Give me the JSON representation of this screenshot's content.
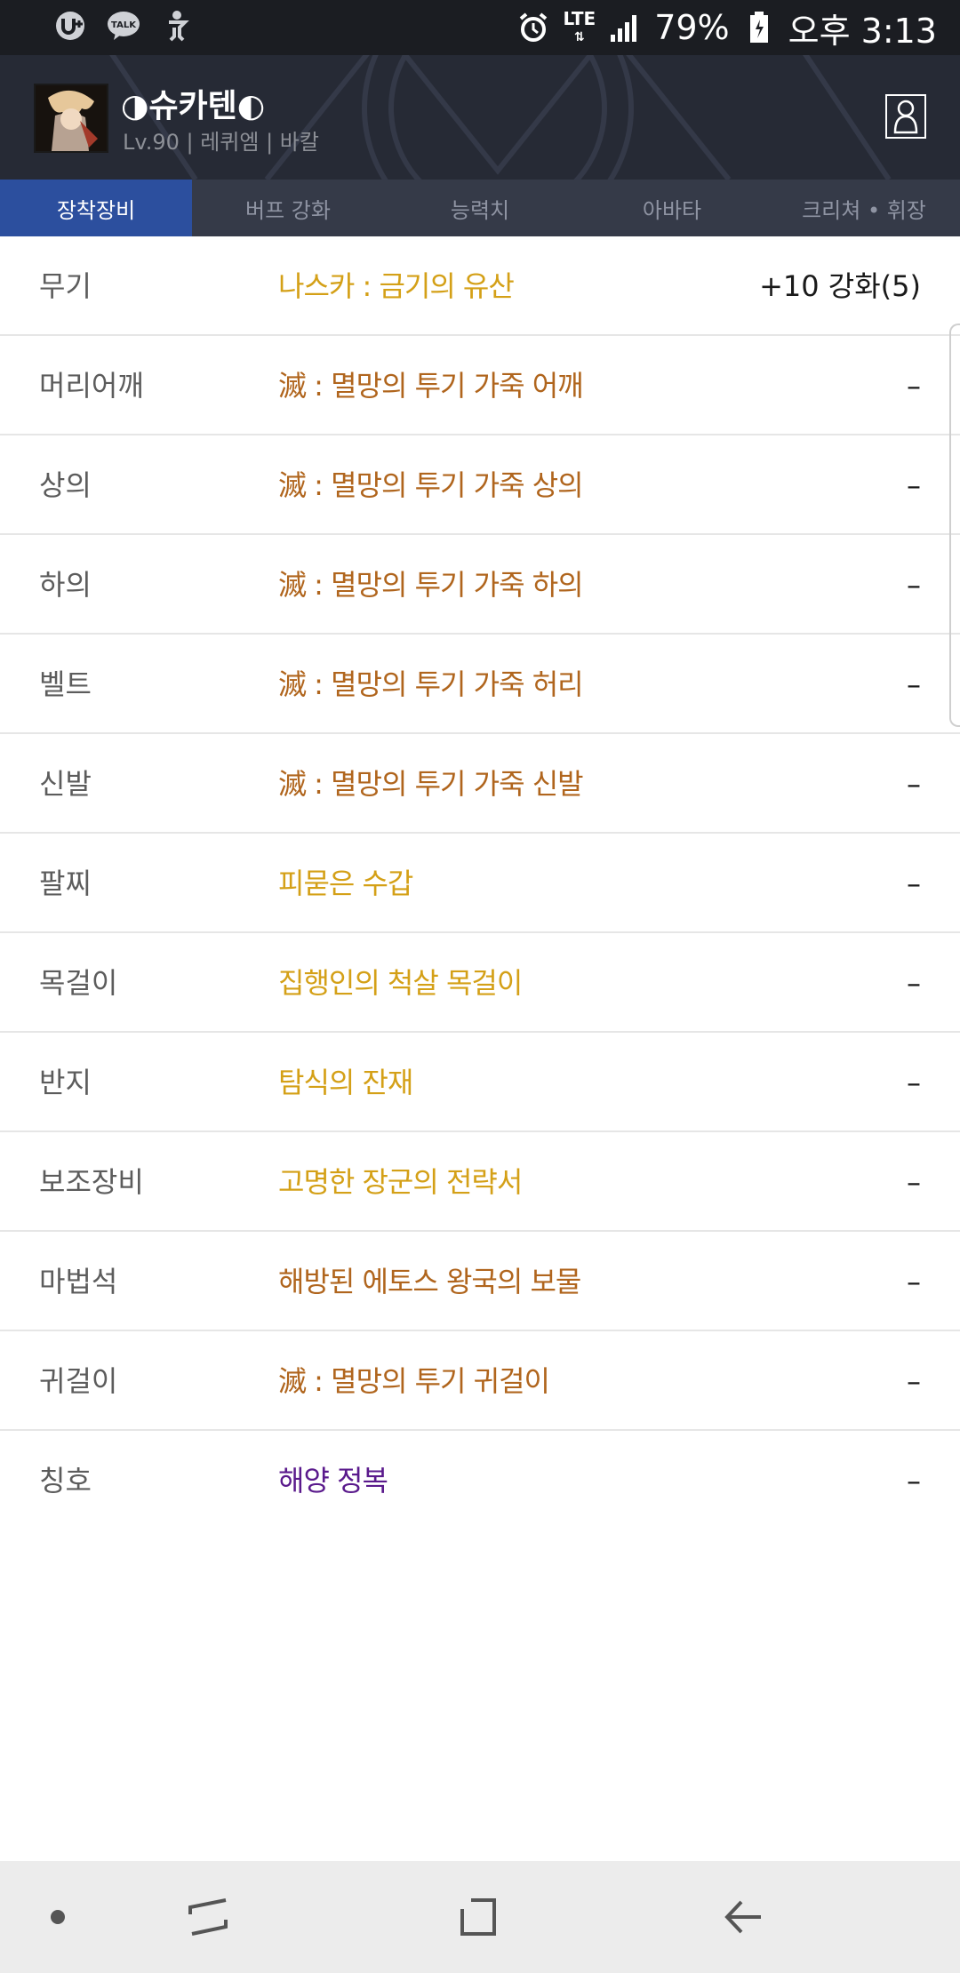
{
  "status_bar": {
    "left_icons": [
      "u-plus-icon",
      "kakaotalk-icon",
      "accessibility-icon"
    ],
    "kakao_label": "TALK",
    "network": "LTE",
    "battery_percent": "79%",
    "time": "오후 3:13"
  },
  "character": {
    "name": "◑슈카텐◐",
    "subtitle": "Lv.90 | 레퀴엠 | 바칼"
  },
  "tabs": [
    {
      "label": "장착장비",
      "active": true
    },
    {
      "label": "버프 강화",
      "active": false
    },
    {
      "label": "능력치",
      "active": false
    },
    {
      "label": "아바타",
      "active": false
    },
    {
      "label": "크리쳐 • 휘장",
      "active": false
    }
  ],
  "equipment": [
    {
      "slot": "무기",
      "item": "나스카 : 금기의 유산",
      "upgrade": "+10 강화(5)",
      "color": "#d4a017"
    },
    {
      "slot": "머리어깨",
      "item": "滅 : 멸망의 투기 가죽 어깨",
      "upgrade": "–",
      "color": "#b0651d"
    },
    {
      "slot": "상의",
      "item": "滅 : 멸망의 투기 가죽 상의",
      "upgrade": "–",
      "color": "#b0651d"
    },
    {
      "slot": "하의",
      "item": "滅 : 멸망의 투기 가죽 하의",
      "upgrade": "–",
      "color": "#b0651d"
    },
    {
      "slot": "벨트",
      "item": "滅 : 멸망의 투기 가죽 허리",
      "upgrade": "–",
      "color": "#b0651d"
    },
    {
      "slot": "신발",
      "item": "滅 : 멸망의 투기 가죽 신발",
      "upgrade": "–",
      "color": "#b0651d"
    },
    {
      "slot": "팔찌",
      "item": "피묻은 수갑",
      "upgrade": "–",
      "color": "#d4a017"
    },
    {
      "slot": "목걸이",
      "item": "집행인의 척살 목걸이",
      "upgrade": "–",
      "color": "#d4a017"
    },
    {
      "slot": "반지",
      "item": "탐식의 잔재",
      "upgrade": "–",
      "color": "#d4a017"
    },
    {
      "slot": "보조장비",
      "item": "고명한 장군의 전략서",
      "upgrade": "–",
      "color": "#d4a017"
    },
    {
      "slot": "마법석",
      "item": "해방된 에토스 왕국의 보물",
      "upgrade": "–",
      "color": "#b0651d"
    },
    {
      "slot": "귀걸이",
      "item": "滅 : 멸망의 투기 귀걸이",
      "upgrade": "–",
      "color": "#b0651d"
    },
    {
      "slot": "칭호",
      "item": "해양 정복",
      "upgrade": "–",
      "color": "#5a1a8c"
    }
  ],
  "nav_bar": [
    "dot-icon",
    "recent-apps-icon",
    "home-icon",
    "back-icon"
  ]
}
